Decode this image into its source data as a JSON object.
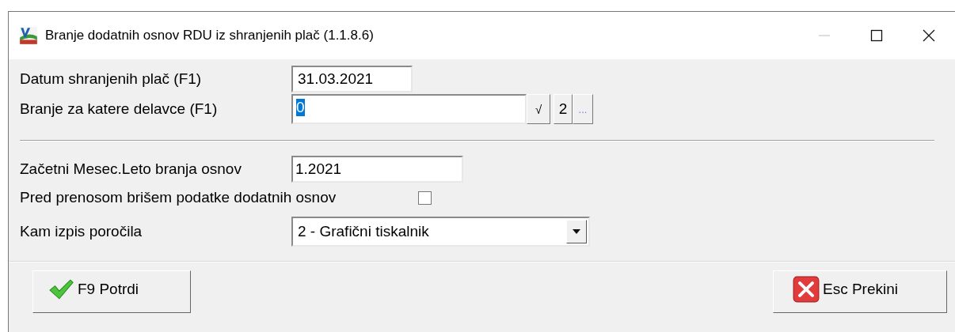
{
  "window": {
    "title": "Branje dodatnih osnov RDU iz shranjenih plač  (1.1.8.6)"
  },
  "date_field": {
    "label": "Datum shranjenih plač (F1)",
    "value": "31.03.2021"
  },
  "workers_field": {
    "label": "Branje za katere delavce (F1)",
    "value": "0",
    "value_highlighted": true,
    "check_button": "√",
    "count": "2",
    "more_button": "..."
  },
  "start_field": {
    "label": "Začetni Mesec.Leto branja osnov",
    "value": "1.2021"
  },
  "delete_option": {
    "label": "Pred prenosom brišem podatke dodatnih osnov",
    "checked": false
  },
  "output_select": {
    "label": "Kam izpis poročila",
    "value": "2 - Grafični tiskalnik"
  },
  "buttons": [
    {
      "kind": "confirm",
      "label": "F9 Potrdi"
    },
    {
      "kind": "cancel",
      "label": "Esc Prekini"
    }
  ]
}
